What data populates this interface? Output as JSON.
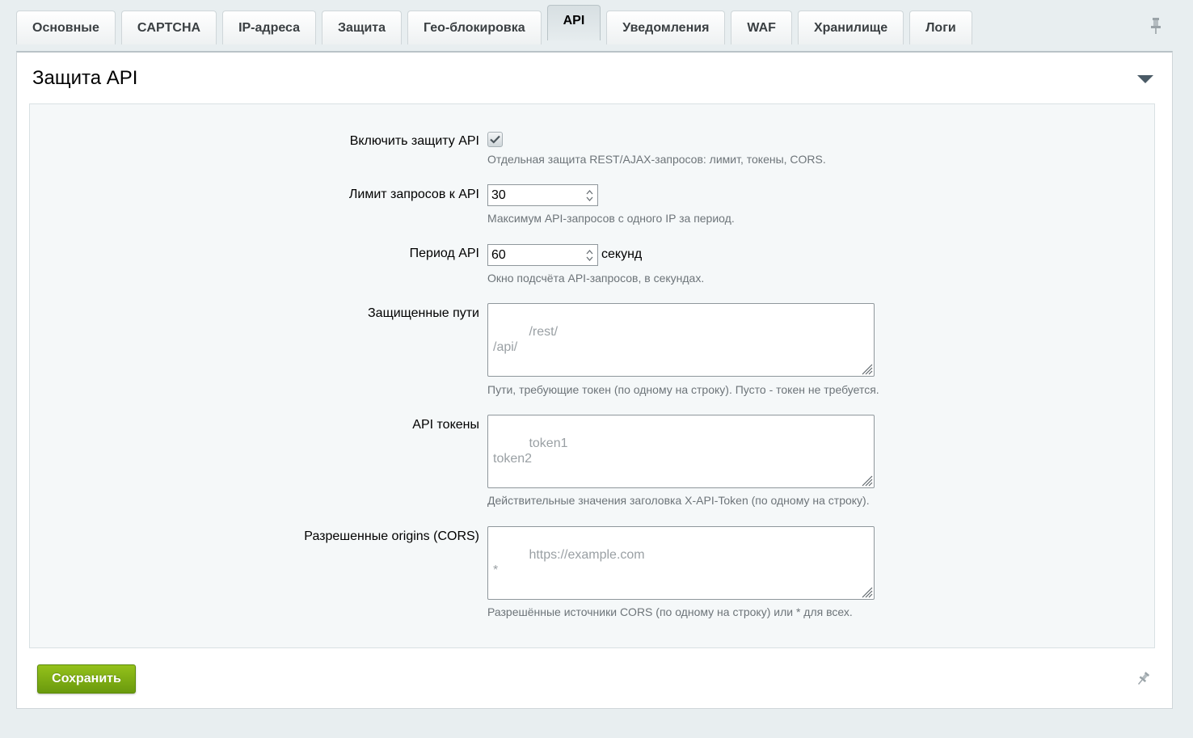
{
  "tabs": [
    "Основные",
    "CAPTCHA",
    "IP-адреса",
    "Защита",
    "Гео-блокировка",
    "API",
    "Уведомления",
    "WAF",
    "Хранилище",
    "Логи"
  ],
  "active_tab": "API",
  "section": {
    "title": "Защита API"
  },
  "fields": {
    "enable": {
      "label": "Включить защиту API",
      "checked": true,
      "hint": "Отдельная защита REST/AJAX-запросов: лимит, токены, CORS."
    },
    "limit": {
      "label": "Лимит запросов к API",
      "value": "30",
      "hint": "Максимум API-запросов с одного IP за период."
    },
    "period": {
      "label": "Период API",
      "value": "60",
      "unit": "секунд",
      "hint": "Окно подсчёта API-запросов, в секундах."
    },
    "paths": {
      "label": "Защищенные пути",
      "placeholder": "/rest/\n/api/",
      "hint": "Пути, требующие токен (по одному на строку). Пусто - токен не требуется."
    },
    "tokens": {
      "label": "API токены",
      "placeholder": "token1\ntoken2",
      "hint": "Действительные значения заголовка X-API-Token (по одному на строку)."
    },
    "origins": {
      "label": "Разрешенные origins (CORS)",
      "placeholder": "https://example.com\n*",
      "hint": "Разрешённые источники CORS (по одному на строку) или * для всех."
    }
  },
  "save_button": "Сохранить",
  "icons": {
    "pin": "pin-icon",
    "collapse": "chevron-down-icon",
    "checkmark": "checkmark-icon",
    "spinner": "spinner-arrows-icon",
    "resize": "resize-grip-icon"
  },
  "colors": {
    "save_button": "#7aab12",
    "background": "#e8eef0",
    "hint_text": "#6d7479"
  }
}
